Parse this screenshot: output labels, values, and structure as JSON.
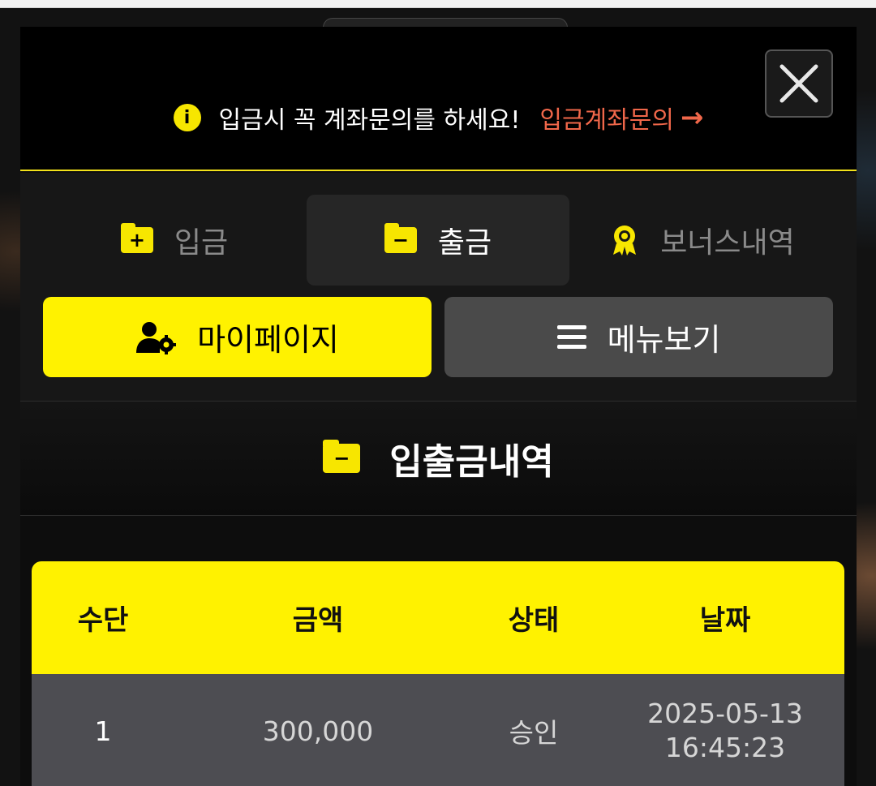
{
  "notice": {
    "text": "입금시 꼭 계좌문의를 하세요!",
    "link_label": "입금계좌문의",
    "link_arrow": "→"
  },
  "close_button": {
    "icon": "close-icon"
  },
  "tabs": [
    {
      "label": "입금",
      "icon": "folder-plus-icon",
      "active": false
    },
    {
      "label": "출금",
      "icon": "folder-minus-icon",
      "active": true
    },
    {
      "label": "보너스내역",
      "icon": "award-icon",
      "active": false
    }
  ],
  "buttons": {
    "mypage_label": "마이페이지",
    "mypage_icon": "user-gear-icon",
    "menu_label": "메뉴보기",
    "menu_icon": "menu-icon"
  },
  "section": {
    "title": "입출금내역",
    "icon": "folder-minus-icon"
  },
  "table": {
    "headers": [
      "수단",
      "금액",
      "상태",
      "날짜"
    ],
    "rows": [
      {
        "method": "1",
        "amount": "300,000",
        "status": "승인",
        "date": "2025-05-13",
        "time": "16:45:23"
      }
    ]
  },
  "colors": {
    "accent": "#fff200",
    "link": "#f0674a",
    "row_bg": "#4d4d52"
  }
}
